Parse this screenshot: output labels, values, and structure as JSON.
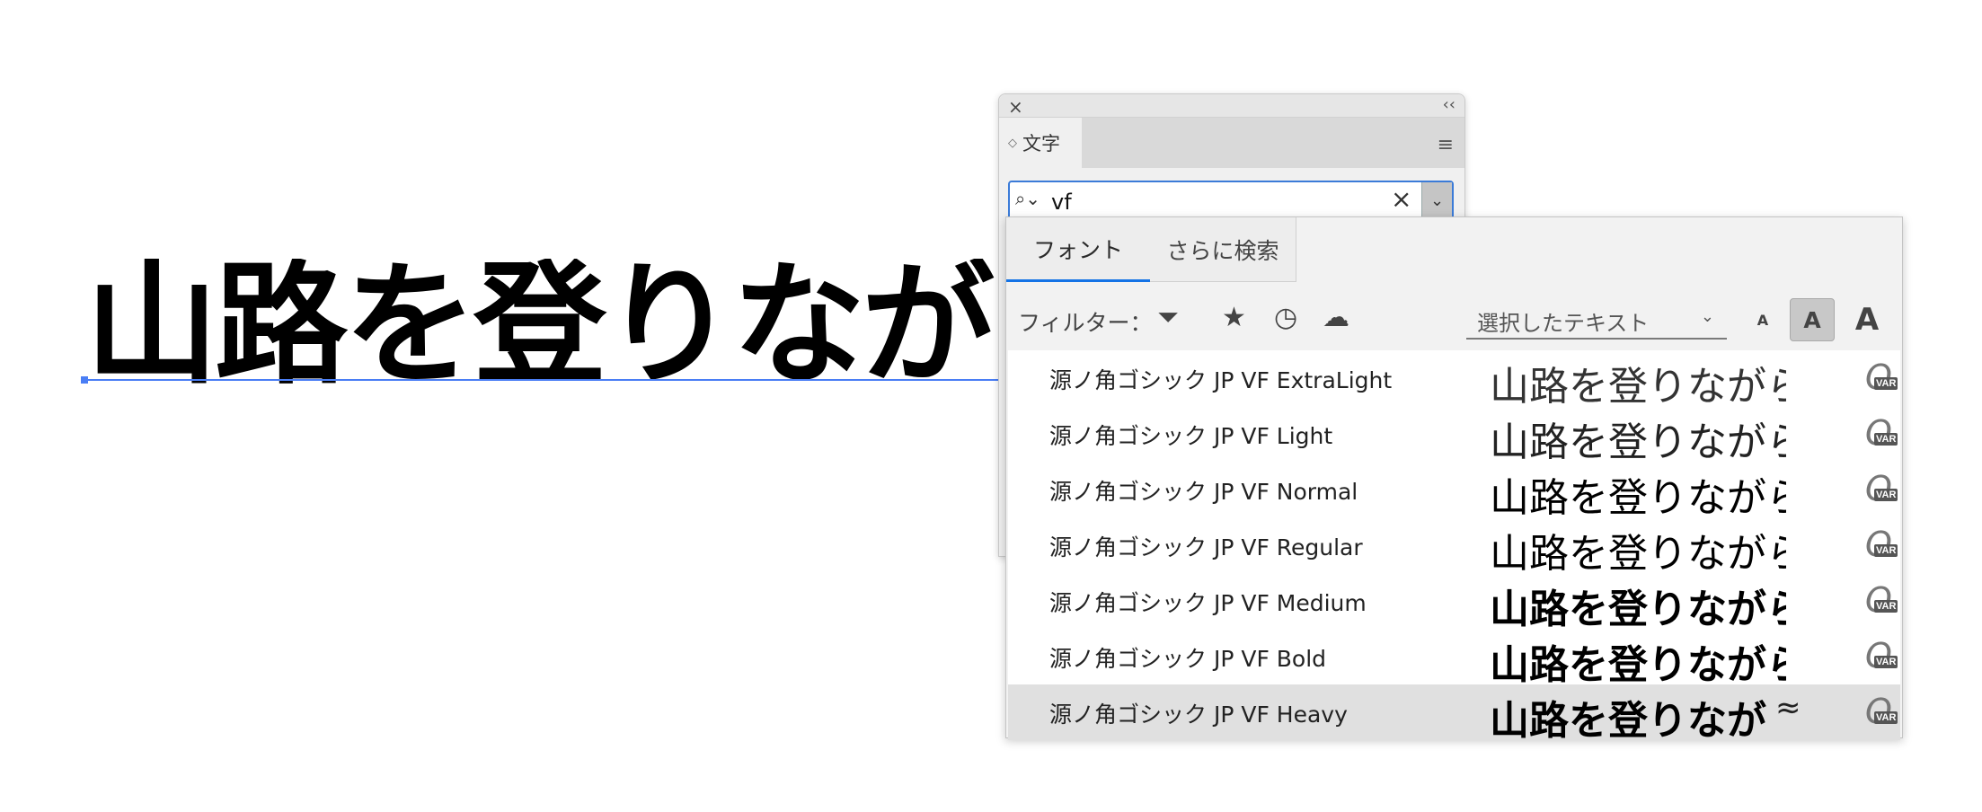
{
  "canvas": {
    "text": "山路を登りながら"
  },
  "panel": {
    "tab_label": "文字",
    "search": {
      "value": "vf"
    }
  },
  "dropdown": {
    "tabs": [
      {
        "label": "フォント"
      },
      {
        "label": "さらに検索"
      }
    ],
    "filter_label": "フィルター：",
    "sample_text_label": "選択したテキスト",
    "size_buttons": [
      "A",
      "A",
      "A"
    ],
    "fonts": [
      {
        "name": "源ノ角ゴシック JP VF ExtraLight",
        "sample": "山路を登りながら",
        "badge": "VAR"
      },
      {
        "name": "源ノ角ゴシック JP VF Light",
        "sample": "山路を登りながら",
        "badge": "VAR"
      },
      {
        "name": "源ノ角ゴシック JP VF Normal",
        "sample": "山路を登りながら",
        "badge": "VAR"
      },
      {
        "name": "源ノ角ゴシック JP VF Regular",
        "sample": "山路を登りながら",
        "badge": "VAR"
      },
      {
        "name": "源ノ角ゴシック JP VF Medium",
        "sample": "山路を登りながら",
        "badge": "VAR"
      },
      {
        "name": "源ノ角ゴシック JP VF Bold",
        "sample": "山路を登りながら",
        "badge": "VAR"
      },
      {
        "name": "源ノ角ゴシック JP VF Heavy",
        "sample": "山路を登りなが",
        "badge": "VAR",
        "selected": true
      }
    ],
    "similar_icon": "≈"
  },
  "colors": {
    "accent": "#1473e6",
    "selection_line": "#4a7ef5"
  }
}
